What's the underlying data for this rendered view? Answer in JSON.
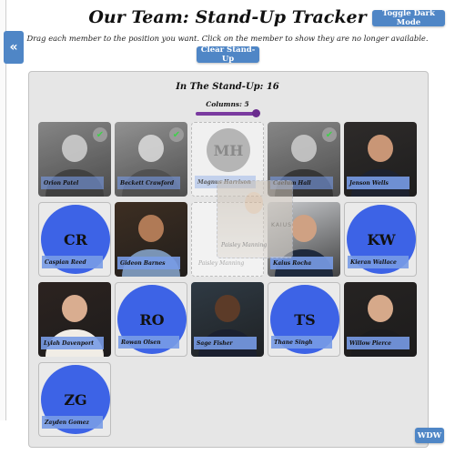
{
  "header": {
    "title": "Our Team: Stand-Up Tracker",
    "instructions": "Drag each member to the position you want. Click on the member to show they are no longer available.",
    "toggle_dark_label": "Toggle Dark Mode",
    "clear_label": "Clear Stand-Up",
    "sidebar_toggle_icon": "«"
  },
  "standup": {
    "count_label": "In The Stand-Up: 16",
    "columns_label": "Columns: 5",
    "columns_value": 5
  },
  "members": [
    {
      "name": "Orion Patel",
      "type": "photo",
      "unavailable": true,
      "bg": "#6b6f73",
      "skin": "#c8c8c8",
      "suit": "#3a3a3a"
    },
    {
      "name": "Beckett Crawford",
      "type": "photo",
      "unavailable": true,
      "bg": "#7d7c7a",
      "skin": "#d2d2d2",
      "suit": "#4a4a4a"
    },
    {
      "name": "Magnus Harrison",
      "type": "placeholder",
      "unavailable": true,
      "initials": "MH"
    },
    {
      "name": "Caelum Hall",
      "type": "photo",
      "unavailable": true,
      "bg": "#707070",
      "skin": "#c4c4c4",
      "suit": "#2e2e2e"
    },
    {
      "name": "Jenson Wells",
      "type": "photo",
      "unavailable": false,
      "bg": "#2e2b2a",
      "skin": "#c99676",
      "suit": "#1d2230"
    },
    {
      "name": "Caspian Reed",
      "type": "initials",
      "unavailable": false,
      "initials": "CR"
    },
    {
      "name": "Gideon Barnes",
      "type": "photo",
      "unavailable": false,
      "bg": "#3d2e22",
      "skin": "#b07a56",
      "suit": "#7a94b5"
    },
    {
      "name": "Paisley Manning",
      "type": "placeholder-ghost",
      "unavailable": false
    },
    {
      "name": "Kaius Rocha",
      "type": "photo",
      "unavailable": false,
      "bg": "#c7c9cc",
      "skin": "#cfa183",
      "suit": "#1f2a3d"
    },
    {
      "name": "Kieran Wallace",
      "type": "initials",
      "unavailable": false,
      "initials": "KW"
    },
    {
      "name": "Lylah Davenport",
      "type": "photo",
      "unavailable": false,
      "bg": "#2c2320",
      "skin": "#d9ad90",
      "suit": "#f1ede6"
    },
    {
      "name": "Rowan Olsen",
      "type": "initials",
      "unavailable": false,
      "initials": "RO"
    },
    {
      "name": "Sage Fisher",
      "type": "photo",
      "unavailable": false,
      "bg": "#2f3a44",
      "skin": "#5c3b28",
      "suit": "#1b2030"
    },
    {
      "name": "Thane Singh",
      "type": "initials",
      "unavailable": false,
      "initials": "TS"
    },
    {
      "name": "Willow Pierce",
      "type": "photo",
      "unavailable": false,
      "bg": "#262322",
      "skin": "#d6a98a",
      "suit": "#1c1c1e"
    },
    {
      "name": "Zayden Gomez",
      "type": "initials",
      "unavailable": false,
      "initials": "ZG"
    }
  ],
  "drag": {
    "ghost_name": "Paisley Manning",
    "drop_label": "Paisley Manning",
    "kaius_sign": "KAIUS"
  },
  "footer": {
    "wdw_label": "WDW"
  },
  "colors": {
    "accent": "#4f86c6",
    "initials_bg": "#3d63e6",
    "slider": "#7a3aa0",
    "check": "#3fd14a"
  }
}
